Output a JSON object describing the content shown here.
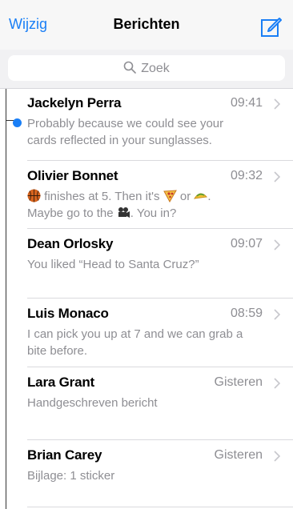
{
  "nav": {
    "edit_label": "Wijzig",
    "title": "Berichten",
    "compose_icon": "compose-icon"
  },
  "search": {
    "placeholder": "Zoek",
    "icon": "search-icon"
  },
  "colors": {
    "accent": "#1a7ff6",
    "secondary_text": "#8e8e93",
    "unread_dot": "#1a7ff6"
  },
  "conversations": [
    {
      "name": "Jackelyn Perra",
      "time": "09:41",
      "unread": true,
      "preview_line1": "Probably because we could see your",
      "preview_line2": "cards reflected in your sunglasses."
    },
    {
      "name": "Olivier Bonnet",
      "time": "09:32",
      "unread": false,
      "preview_parts": [
        "finishes at 5. Then it's",
        "or",
        "."
      ],
      "preview_line2_parts": [
        "Maybe go to the",
        ". You in?"
      ],
      "emojis": [
        "basketball-emoji",
        "pizza-emoji",
        "taco-emoji",
        "movie-camera-emoji"
      ]
    },
    {
      "name": "Dean Orlosky",
      "time": "09:07",
      "unread": false,
      "preview_line1": "You liked “Head to Santa Cruz?”"
    },
    {
      "name": "Luis Monaco",
      "time": "08:59",
      "unread": false,
      "preview_line1": "I can pick you up at 7 and we can grab a",
      "preview_line2": "bite before."
    },
    {
      "name": "Lara Grant",
      "time": "Gisteren",
      "unread": false,
      "preview_line1": "Handgeschreven bericht"
    },
    {
      "name": "Brian Carey",
      "time": "Gisteren",
      "unread": false,
      "preview_line1": "Bijlage: 1 sticker"
    }
  ]
}
